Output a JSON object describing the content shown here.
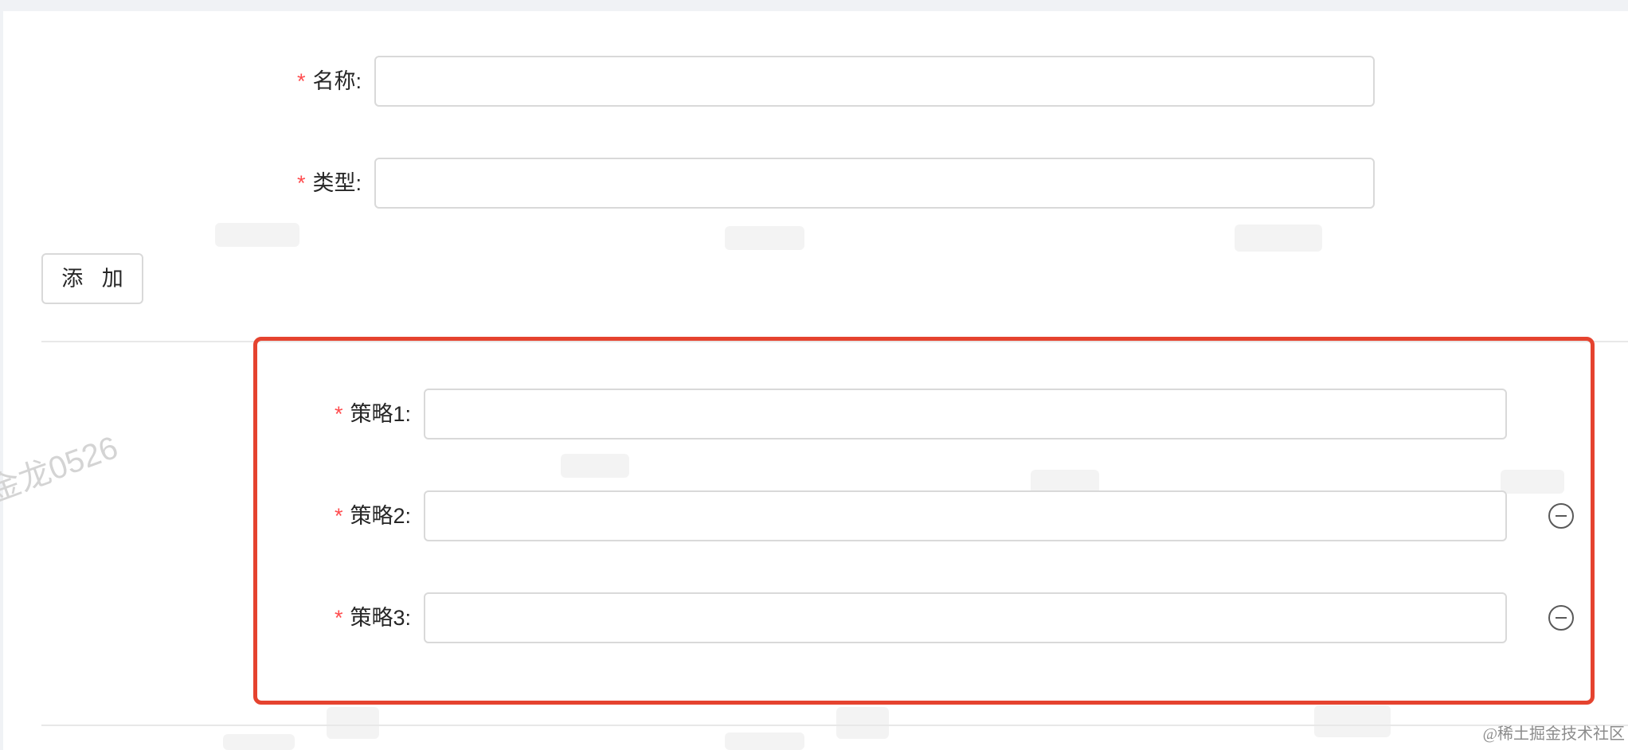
{
  "form": {
    "name_field": {
      "label": "名称",
      "colon": ":",
      "required_mark": "*",
      "value": ""
    },
    "type_field": {
      "label": "类型",
      "colon": ":",
      "required_mark": "*",
      "value": ""
    },
    "add_button_label": "添 加"
  },
  "strategies": [
    {
      "label": "策略1",
      "colon": ":",
      "required_mark": "*",
      "value": "",
      "removable": false
    },
    {
      "label": "策略2",
      "colon": ":",
      "required_mark": "*",
      "value": "",
      "removable": true
    },
    {
      "label": "策略3",
      "colon": ":",
      "required_mark": "*",
      "value": "",
      "removable": true
    }
  ],
  "icons": {
    "remove": "minus-circle-icon"
  },
  "colors": {
    "required": "#ff4d4f",
    "highlight_border": "#e5432f",
    "input_border": "#d9d9d9"
  },
  "watermark": {
    "text": "金龙0526"
  },
  "credit": {
    "text": "@稀土掘金技术社区"
  }
}
